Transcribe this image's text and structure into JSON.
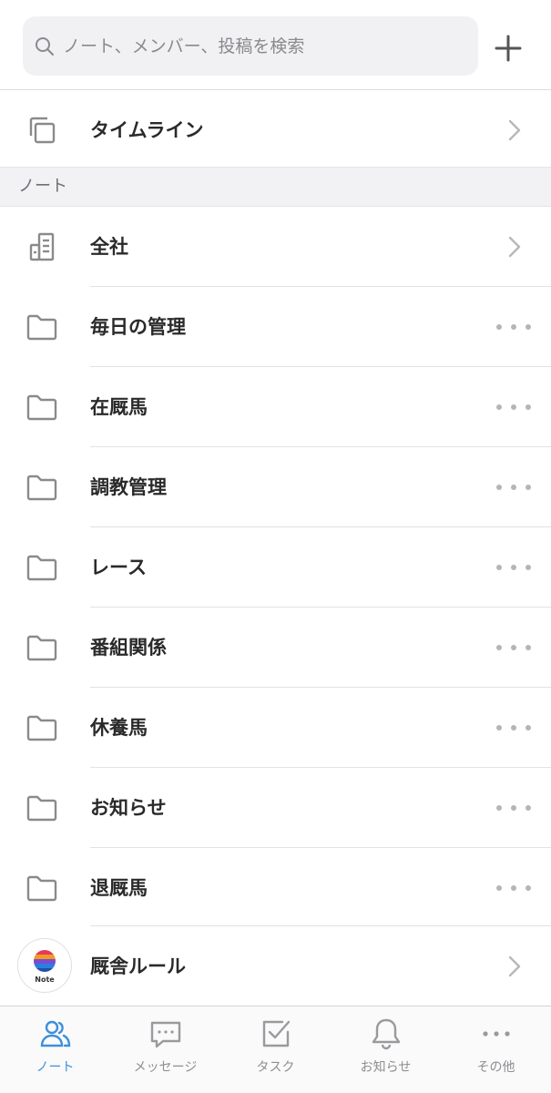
{
  "search": {
    "placeholder": "ノート、メンバー、投稿を検索"
  },
  "timeline": {
    "label": "タイムライン"
  },
  "section": {
    "title": "ノート"
  },
  "notes": [
    {
      "label": "全社",
      "action": "chevron"
    },
    {
      "label": "毎日の管理",
      "action": "more"
    },
    {
      "label": "在厩馬",
      "action": "more"
    },
    {
      "label": "調教管理",
      "action": "more"
    },
    {
      "label": "レース",
      "action": "more"
    },
    {
      "label": "番組関係",
      "action": "more"
    },
    {
      "label": "休養馬",
      "action": "more"
    },
    {
      "label": "お知らせ",
      "action": "more"
    },
    {
      "label": "退厩馬",
      "action": "more"
    }
  ],
  "rules": {
    "label": "厩舎ルール",
    "avatar_text": "Note"
  },
  "tabs": [
    {
      "label": "ノート",
      "icon": "people-icon",
      "active": true
    },
    {
      "label": "メッセージ",
      "icon": "chat-bubble-icon",
      "active": false
    },
    {
      "label": "タスク",
      "icon": "checkbox-icon",
      "active": false
    },
    {
      "label": "お知らせ",
      "icon": "bell-icon",
      "active": false
    },
    {
      "label": "その他",
      "icon": "more-horizontal-icon",
      "active": false
    }
  ],
  "colors": {
    "accent": "#3d8fdc",
    "icon_gray": "#8a8a8a",
    "section_bg": "#f2f2f4"
  }
}
